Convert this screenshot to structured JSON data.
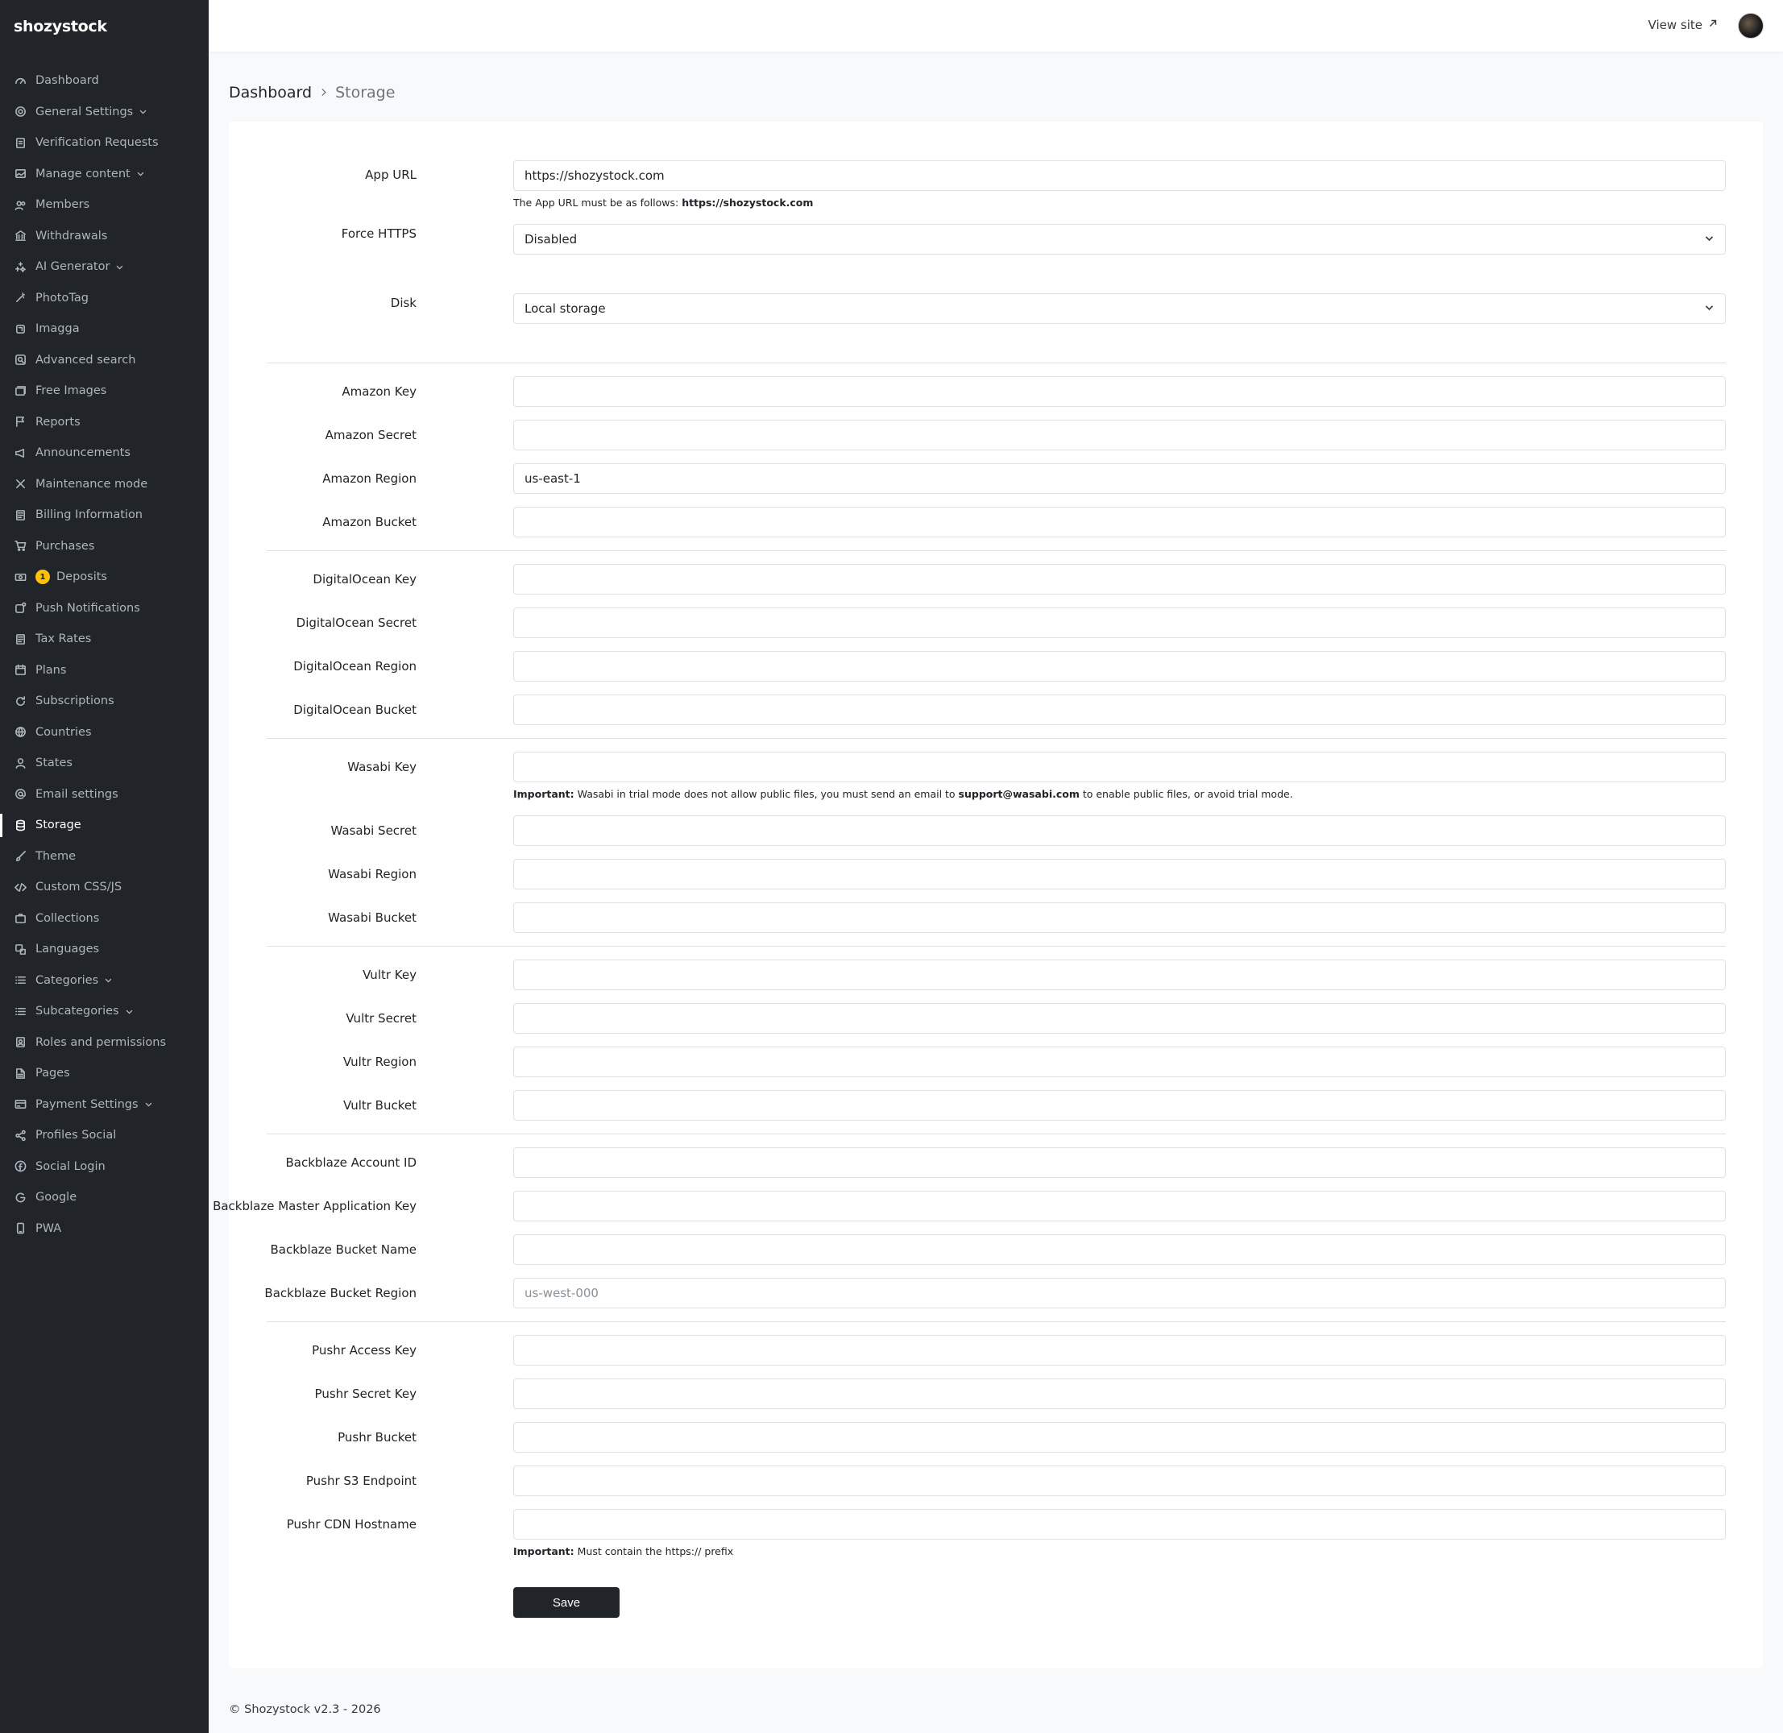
{
  "app": {
    "logo": "shozystock"
  },
  "topbar": {
    "view_site": "View site"
  },
  "breadcrumb": {
    "home": "Dashboard",
    "current": "Storage"
  },
  "sidebar": {
    "items": [
      {
        "label": "Dashboard",
        "icon": "dashboard-icon"
      },
      {
        "label": "General Settings",
        "icon": "gear-icon",
        "chevron": true
      },
      {
        "label": "Verification Requests",
        "icon": "document-icon"
      },
      {
        "label": "Manage content",
        "icon": "image-icon",
        "chevron": true
      },
      {
        "label": "Members",
        "icon": "people-icon"
      },
      {
        "label": "Withdrawals",
        "icon": "bank-icon"
      },
      {
        "label": "AI Generator",
        "icon": "sparkles-icon",
        "chevron": true
      },
      {
        "label": "PhotoTag",
        "icon": "magic-wand-icon"
      },
      {
        "label": "Imagga",
        "icon": "imagga-icon"
      },
      {
        "label": "Advanced search",
        "icon": "search-box-icon"
      },
      {
        "label": "Free Images",
        "icon": "images-icon"
      },
      {
        "label": "Reports",
        "icon": "flag-icon"
      },
      {
        "label": "Announcements",
        "icon": "megaphone-icon"
      },
      {
        "label": "Maintenance mode",
        "icon": "tools-icon"
      },
      {
        "label": "Billing Information",
        "icon": "receipt-icon"
      },
      {
        "label": "Purchases",
        "icon": "cart-icon"
      },
      {
        "label": "Deposits",
        "icon": "cash-icon",
        "badge": "1"
      },
      {
        "label": "Push Notifications",
        "icon": "notification-icon"
      },
      {
        "label": "Tax Rates",
        "icon": "receipt-icon"
      },
      {
        "label": "Plans",
        "icon": "calendar-icon"
      },
      {
        "label": "Subscriptions",
        "icon": "refresh-icon"
      },
      {
        "label": "Countries",
        "icon": "globe-icon"
      },
      {
        "label": "States",
        "icon": "person-icon"
      },
      {
        "label": "Email settings",
        "icon": "at-icon"
      },
      {
        "label": "Storage",
        "icon": "database-icon",
        "active": true
      },
      {
        "label": "Theme",
        "icon": "brush-icon"
      },
      {
        "label": "Custom CSS/JS",
        "icon": "code-icon"
      },
      {
        "label": "Collections",
        "icon": "briefcase-icon"
      },
      {
        "label": "Languages",
        "icon": "translate-icon"
      },
      {
        "label": "Categories",
        "icon": "list-icon",
        "chevron": true
      },
      {
        "label": "Subcategories",
        "icon": "list-icon",
        "chevron": true
      },
      {
        "label": "Roles and permissions",
        "icon": "shield-icon"
      },
      {
        "label": "Pages",
        "icon": "file-icon"
      },
      {
        "label": "Payment Settings",
        "icon": "credit-card-icon",
        "chevron": true
      },
      {
        "label": "Profiles Social",
        "icon": "share-icon"
      },
      {
        "label": "Social Login",
        "icon": "facebook-icon"
      },
      {
        "label": "Google",
        "icon": "google-icon"
      },
      {
        "label": "PWA",
        "icon": "phone-icon"
      }
    ]
  },
  "form": {
    "app_url": {
      "label": "App URL",
      "value": "https://shozystock.com",
      "help_prefix": "The App URL must be as follows: ",
      "help_bold": "https://shozystock.com"
    },
    "force_https": {
      "label": "Force HTTPS",
      "value": "Disabled"
    },
    "disk": {
      "label": "Disk",
      "value": "Local storage"
    },
    "amazon_key": {
      "label": "Amazon Key",
      "value": ""
    },
    "amazon_secret": {
      "label": "Amazon Secret",
      "value": ""
    },
    "amazon_region": {
      "label": "Amazon Region",
      "value": "us-east-1"
    },
    "amazon_bucket": {
      "label": "Amazon Bucket",
      "value": ""
    },
    "do_key": {
      "label": "DigitalOcean Key",
      "value": ""
    },
    "do_secret": {
      "label": "DigitalOcean Secret",
      "value": ""
    },
    "do_region": {
      "label": "DigitalOcean Region",
      "value": ""
    },
    "do_bucket": {
      "label": "DigitalOcean Bucket",
      "value": ""
    },
    "wasabi_key": {
      "label": "Wasabi Key",
      "value": ""
    },
    "wasabi_note": {
      "bold": "Important:",
      "text1": " Wasabi in trial mode does not allow public files, you must send an email to ",
      "email": "support@wasabi.com",
      "text2": " to enable public files, or avoid trial mode."
    },
    "wasabi_secret": {
      "label": "Wasabi Secret",
      "value": ""
    },
    "wasabi_region": {
      "label": "Wasabi Region",
      "value": ""
    },
    "wasabi_bucket": {
      "label": "Wasabi Bucket",
      "value": ""
    },
    "vultr_key": {
      "label": "Vultr Key",
      "value": ""
    },
    "vultr_secret": {
      "label": "Vultr Secret",
      "value": ""
    },
    "vultr_region": {
      "label": "Vultr Region",
      "value": ""
    },
    "vultr_bucket": {
      "label": "Vultr Bucket",
      "value": ""
    },
    "bb_account": {
      "label": "Backblaze Account ID",
      "value": ""
    },
    "bb_master": {
      "label": "Backblaze Master Application Key",
      "value": ""
    },
    "bb_bucket": {
      "label": "Backblaze Bucket Name",
      "value": ""
    },
    "bb_region": {
      "label": "Backblaze Bucket Region",
      "placeholder": "us-west-000"
    },
    "pushr_access": {
      "label": "Pushr Access Key",
      "value": ""
    },
    "pushr_secret": {
      "label": "Pushr Secret Key",
      "value": ""
    },
    "pushr_bucket": {
      "label": "Pushr Bucket",
      "value": ""
    },
    "pushr_endpoint": {
      "label": "Pushr S3 Endpoint",
      "value": ""
    },
    "pushr_cdn": {
      "label": "Pushr CDN Hostname",
      "value": ""
    },
    "pushr_note": {
      "bold": "Important:",
      "text": " Must contain the https:// prefix"
    },
    "save_label": "Save"
  },
  "footer": {
    "text": "© Shozystock v2.3 - 2026"
  }
}
